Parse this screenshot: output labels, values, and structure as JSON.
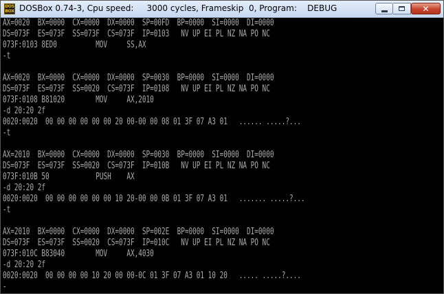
{
  "window": {
    "title": "DOSBox 0.74-3, Cpu speed:     3000 cycles, Frameskip  0, Program:    DEBUG",
    "icon_text_top": "DOS",
    "icon_text_bottom": "BOX",
    "close_glyph": "✕"
  },
  "console": {
    "lines": [
      "AX=0020  BX=0000  CX=0000  DX=0000  SP=00FD  BP=0000  SI=0000  DI=0000",
      "DS=073F  ES=073F  SS=073F  CS=073F  IP=0103   NV UP EI PL NZ NA PO NC",
      "073F:0103 8ED0          MOV     SS,AX",
      "-t",
      "",
      "AX=0020  BX=0000  CX=0000  DX=0000  SP=0030  BP=0000  SI=0000  DI=0000",
      "DS=073F  ES=073F  SS=0020  CS=073F  IP=0108   NV UP EI PL NZ NA PO NC",
      "073F:0108 B81020        MOV     AX,2010",
      "-d 20:20 2f",
      "0020:0020  00 00 00 00 00 00 20 00-00 00 08 01 3F 07 A3 01   ...... .....?...",
      "-t",
      "",
      "AX=2010  BX=0000  CX=0000  DX=0000  SP=0030  BP=0000  SI=0000  DI=0000",
      "DS=073F  ES=073F  SS=0020  CS=073F  IP=010B   NV UP EI PL NZ NA PO NC",
      "073F:010B 50            PUSH    AX",
      "-d 20:20 2f",
      "0020:0020  00 00 00 00 00 00 10 20-00 00 0B 01 3F 07 A3 01   ....... .....?...",
      "-t",
      "",
      "AX=2010  BX=0000  CX=0000  DX=0000  SP=002E  BP=0000  SI=0000  DI=0000",
      "DS=073F  ES=073F  SS=0020  CS=073F  IP=010C   NV UP EI PL NZ NA PO NC",
      "073F:010C B83040        MOV     AX,4030",
      "-d 20:20 2f",
      "0020:0020  00 00 00 00 10 20 00 00-0C 01 3F 07 A3 01 10 20   ..... .....?....",
      "-",
      ""
    ]
  }
}
